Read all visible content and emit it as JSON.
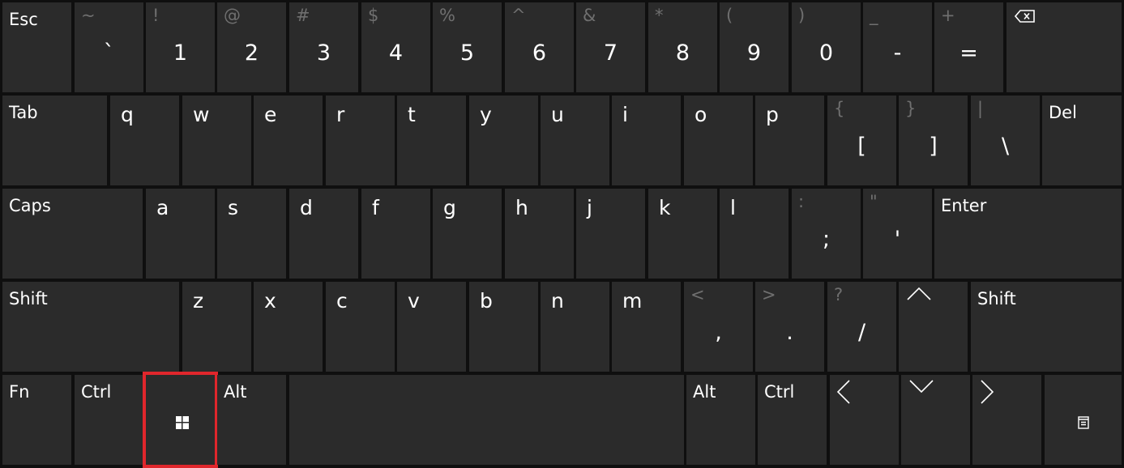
{
  "rows": [
    [
      {
        "id": "esc",
        "type": "func",
        "label": "Esc"
      },
      {
        "id": "backtick",
        "type": "sym",
        "shift": "~",
        "main": "`"
      },
      {
        "id": "1",
        "type": "sym",
        "shift": "!",
        "main": "1"
      },
      {
        "id": "2",
        "type": "sym",
        "shift": "@",
        "main": "2"
      },
      {
        "id": "3",
        "type": "sym",
        "shift": "#",
        "main": "3"
      },
      {
        "id": "4",
        "type": "sym",
        "shift": "$",
        "main": "4"
      },
      {
        "id": "5",
        "type": "sym",
        "shift": "%",
        "main": "5"
      },
      {
        "id": "6",
        "type": "sym",
        "shift": "^",
        "main": "6"
      },
      {
        "id": "7",
        "type": "sym",
        "shift": "&",
        "main": "7"
      },
      {
        "id": "8",
        "type": "sym",
        "shift": "*",
        "main": "8"
      },
      {
        "id": "9",
        "type": "sym",
        "shift": "(",
        "main": "9"
      },
      {
        "id": "0",
        "type": "sym",
        "shift": ")",
        "main": "0"
      },
      {
        "id": "minus",
        "type": "sym",
        "shift": "_",
        "main": "-"
      },
      {
        "id": "equals",
        "type": "sym",
        "shift": "+",
        "main": "="
      },
      {
        "id": "backspace",
        "type": "icon",
        "icon": "backspace-icon"
      }
    ],
    [
      {
        "id": "tab",
        "type": "func",
        "label": "Tab"
      },
      {
        "id": "q",
        "type": "letter",
        "label": "q"
      },
      {
        "id": "w",
        "type": "letter",
        "label": "w"
      },
      {
        "id": "e",
        "type": "letter",
        "label": "e"
      },
      {
        "id": "r",
        "type": "letter",
        "label": "r"
      },
      {
        "id": "t",
        "type": "letter",
        "label": "t"
      },
      {
        "id": "y",
        "type": "letter",
        "label": "y"
      },
      {
        "id": "u",
        "type": "letter",
        "label": "u"
      },
      {
        "id": "i",
        "type": "letter",
        "label": "i"
      },
      {
        "id": "o",
        "type": "letter",
        "label": "o"
      },
      {
        "id": "p",
        "type": "letter",
        "label": "p"
      },
      {
        "id": "lbracket",
        "type": "sym",
        "shift": "{",
        "main": "["
      },
      {
        "id": "rbracket",
        "type": "sym",
        "shift": "}",
        "main": "]"
      },
      {
        "id": "backslash",
        "type": "sym",
        "shift": "|",
        "main": "\\"
      },
      {
        "id": "del",
        "type": "func",
        "label": "Del"
      }
    ],
    [
      {
        "id": "caps",
        "type": "func",
        "label": "Caps"
      },
      {
        "id": "a",
        "type": "letter",
        "label": "a"
      },
      {
        "id": "s",
        "type": "letter",
        "label": "s"
      },
      {
        "id": "d",
        "type": "letter",
        "label": "d"
      },
      {
        "id": "f",
        "type": "letter",
        "label": "f"
      },
      {
        "id": "g",
        "type": "letter",
        "label": "g"
      },
      {
        "id": "h",
        "type": "letter",
        "label": "h"
      },
      {
        "id": "j",
        "type": "letter",
        "label": "j"
      },
      {
        "id": "k",
        "type": "letter",
        "label": "k"
      },
      {
        "id": "l",
        "type": "letter",
        "label": "l"
      },
      {
        "id": "semicolon",
        "type": "sym",
        "shift": ":",
        "main": ";"
      },
      {
        "id": "quote",
        "type": "sym",
        "shift": "\"",
        "main": "'"
      },
      {
        "id": "enter",
        "type": "func",
        "label": "Enter"
      }
    ],
    [
      {
        "id": "shift-left",
        "type": "func",
        "label": "Shift"
      },
      {
        "id": "z",
        "type": "letter",
        "label": "z"
      },
      {
        "id": "x",
        "type": "letter",
        "label": "x"
      },
      {
        "id": "c",
        "type": "letter",
        "label": "c"
      },
      {
        "id": "v",
        "type": "letter",
        "label": "v"
      },
      {
        "id": "b",
        "type": "letter",
        "label": "b"
      },
      {
        "id": "n",
        "type": "letter",
        "label": "n"
      },
      {
        "id": "m",
        "type": "letter",
        "label": "m"
      },
      {
        "id": "comma",
        "type": "sym",
        "shift": "<",
        "main": ","
      },
      {
        "id": "period",
        "type": "sym",
        "shift": ">",
        "main": "."
      },
      {
        "id": "slash",
        "type": "sym",
        "shift": "?",
        "main": "/"
      },
      {
        "id": "up",
        "type": "icon",
        "icon": "arrow-up-icon"
      },
      {
        "id": "shift-right",
        "type": "func",
        "label": "Shift"
      }
    ],
    [
      {
        "id": "fn",
        "type": "func",
        "label": "Fn"
      },
      {
        "id": "ctrl-left",
        "type": "func",
        "label": "Ctrl"
      },
      {
        "id": "win",
        "type": "icon",
        "icon": "windows-logo-icon",
        "selected": true
      },
      {
        "id": "alt-left",
        "type": "func",
        "label": "Alt"
      },
      {
        "id": "space",
        "type": "blank"
      },
      {
        "id": "alt-right",
        "type": "func",
        "label": "Alt"
      },
      {
        "id": "ctrl-right",
        "type": "func",
        "label": "Ctrl"
      },
      {
        "id": "left",
        "type": "icon",
        "icon": "arrow-left-icon"
      },
      {
        "id": "down",
        "type": "icon",
        "icon": "arrow-down-icon"
      },
      {
        "id": "right",
        "type": "icon",
        "icon": "arrow-right-icon"
      },
      {
        "id": "menu",
        "type": "icon",
        "icon": "context-menu-icon"
      }
    ]
  ],
  "colors": {
    "key": "#2b2b2b",
    "background": "#0f0f0f",
    "label": "#ffffff",
    "secondary_label": "#6f6f6f",
    "highlight": "#e0262c"
  }
}
